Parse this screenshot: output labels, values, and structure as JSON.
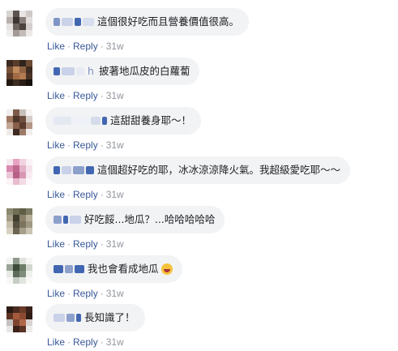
{
  "actions": {
    "like_label": "Like",
    "reply_label": "Reply",
    "separator": "·"
  },
  "comments": [
    {
      "text": "這個很好吃而且營養價值很高。",
      "time": "31w",
      "name_fragment": "",
      "emoji": ""
    },
    {
      "text": "披著地瓜皮的白蘿蔔",
      "time": "31w",
      "name_fragment": "h",
      "emoji": ""
    },
    {
      "text": "這甜甜養身耶～！",
      "time": "31w",
      "name_fragment": "",
      "emoji": ""
    },
    {
      "text": "這個超好吃的耶，冰冰涼涼降火氣。我超級愛吃耶～～",
      "time": "31w",
      "name_fragment": "",
      "emoji": ""
    },
    {
      "text": "好吃餒...地瓜？...哈哈哈哈哈",
      "time": "31w",
      "name_fragment": "",
      "emoji": ""
    },
    {
      "text": "我也會看成地瓜",
      "time": "31w",
      "name_fragment": "",
      "emoji": "rolling-on-floor-laughing"
    },
    {
      "text": "長知識了！",
      "time": "31w",
      "name_fragment": "",
      "emoji": ""
    }
  ],
  "colors": {
    "bubble": "#f2f3f5",
    "link": "#385898",
    "meta": "#90949c",
    "name_blur": "#4267b2"
  }
}
